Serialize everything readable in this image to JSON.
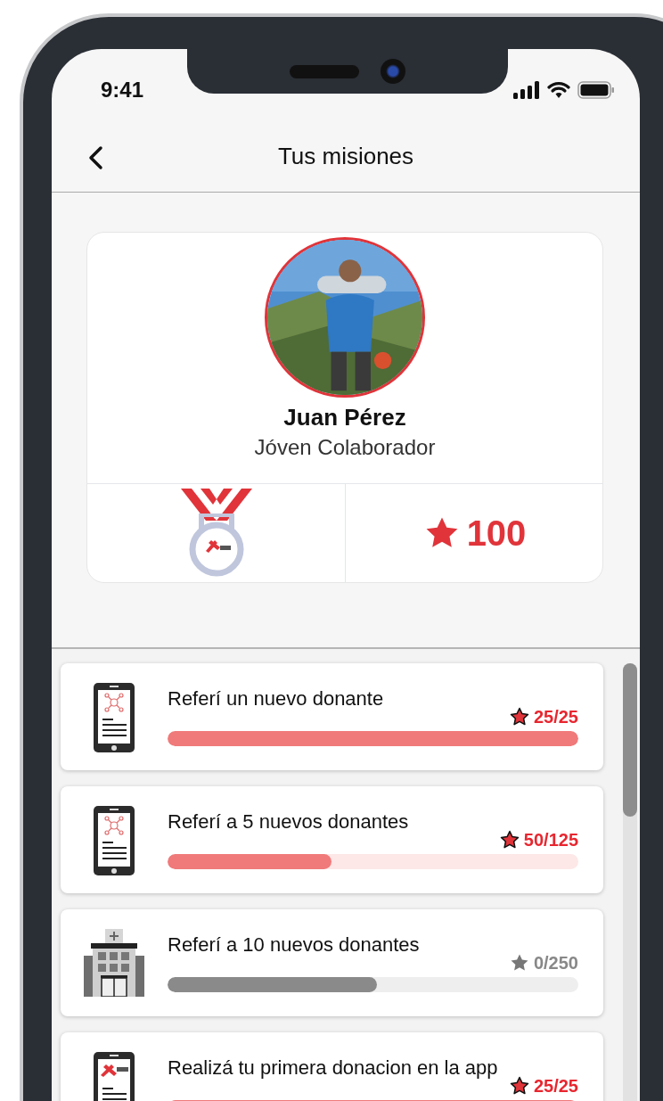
{
  "status_bar": {
    "time": "9:41"
  },
  "header": {
    "title": "Tus misiones"
  },
  "profile": {
    "name": "Juan Pérez",
    "role": "Jóven Colaborador",
    "points": "100"
  },
  "missions": [
    {
      "title": "Referí un nuevo donante",
      "score": "25/25",
      "level": 1,
      "locked": false,
      "kind": "referral"
    },
    {
      "title": "Referí a 5 nuevos donantes",
      "score": "50/125",
      "level": 0.4,
      "locked": false,
      "kind": "referral"
    },
    {
      "title": "Referí a 10 nuevos donantes",
      "score": "0/250",
      "level": 0.51,
      "locked": true,
      "kind": "hospital"
    },
    {
      "title": "Realizá tu primera donacion en la app",
      "score": "25/25",
      "level": 1,
      "locked": false,
      "kind": "donation"
    }
  ]
}
